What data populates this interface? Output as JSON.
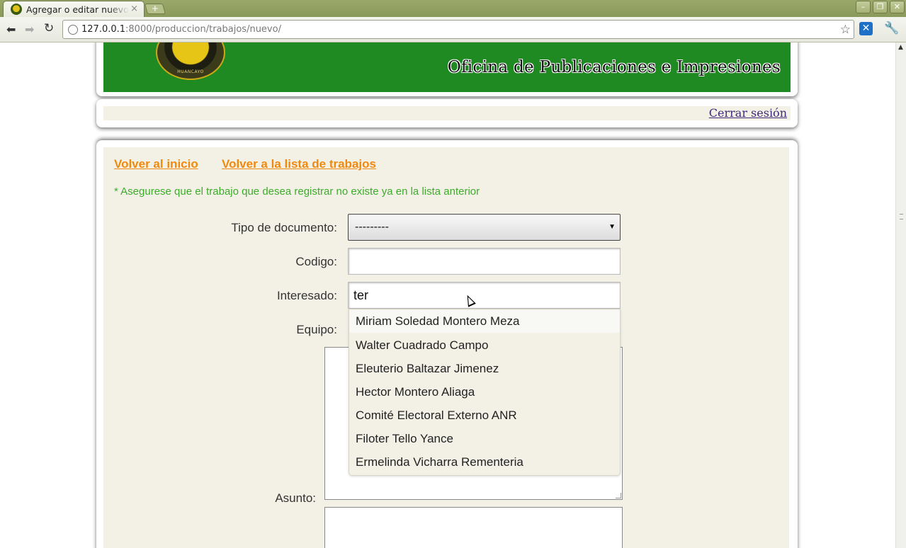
{
  "browser": {
    "tab_title": "Agregar o editar nuevos",
    "tab_close": "×",
    "new_tab": "+",
    "url_host": "127.0.0.1",
    "url_rest": ":8000/produccion/trabajos/nuevo/",
    "window_buttons": [
      "–",
      "❐",
      "✕"
    ],
    "icons": [
      "back-icon",
      "forward-icon",
      "reload-icon",
      "page-info-icon",
      "star-icon",
      "extension-icon",
      "wrench-icon"
    ]
  },
  "header": {
    "seal_text": "HUANCAYO",
    "title": "Oficina de Publicaciones e Impresiones",
    "banner_color": "#1f8a22"
  },
  "session": {
    "logout": "Cerrar sesión"
  },
  "nav": {
    "home": "Volver al inicio",
    "list": "Volver a la lista de trabajos",
    "link_color": "#f08a0f"
  },
  "notice": "* Asegurese que el trabajo que desea registrar no existe ya en la lista anterior",
  "form": {
    "tipo_label": "Tipo de documento:",
    "tipo_value": "---------",
    "codigo_label": "Codigo:",
    "codigo_value": "",
    "interesado_label": "Interesado:",
    "interesado_value": "ter",
    "equipo_label": "Equipo:",
    "asunto_label": "Asunto:"
  },
  "autocomplete": {
    "items": [
      "Miriam Soledad Montero Meza",
      "Walter Cuadrado Campo",
      "Eleuterio Baltazar Jimenez",
      "Hector Montero Aliaga",
      "Comité Electoral Externo ANR",
      "Filoter Tello Yance",
      "Ermelinda Vicharra Rementeria"
    ]
  }
}
